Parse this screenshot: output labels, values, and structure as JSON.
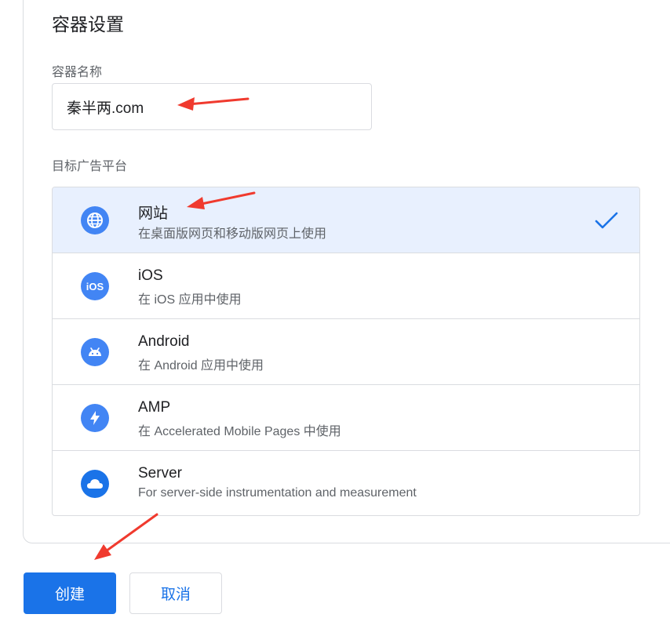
{
  "section": {
    "title": "容器设置"
  },
  "container_name": {
    "label": "容器名称",
    "value": "秦半两.com"
  },
  "platform": {
    "label": "目标广告平台",
    "selected": "website",
    "items": [
      {
        "id": "website",
        "title": "网站",
        "subtitle": "在桌面版网页和移动版网页上使用",
        "icon": "globe-icon"
      },
      {
        "id": "ios",
        "title": "iOS",
        "subtitle": "在 iOS 应用中使用",
        "icon": "ios-icon"
      },
      {
        "id": "android",
        "title": "Android",
        "subtitle": "在 Android 应用中使用",
        "icon": "android-icon"
      },
      {
        "id": "amp",
        "title": "AMP",
        "subtitle": "在 Accelerated Mobile Pages 中使用",
        "icon": "lightning-icon"
      },
      {
        "id": "server",
        "title": "Server",
        "subtitle": "For server-side instrumentation and measurement",
        "icon": "cloud-icon"
      }
    ]
  },
  "actions": {
    "create_label": "创建",
    "cancel_label": "取消"
  },
  "colors": {
    "accent": "#1a73e8",
    "selected_bg": "#e8f0fe",
    "border": "#dadce0",
    "annotation_arrow": "#f03a2e"
  }
}
